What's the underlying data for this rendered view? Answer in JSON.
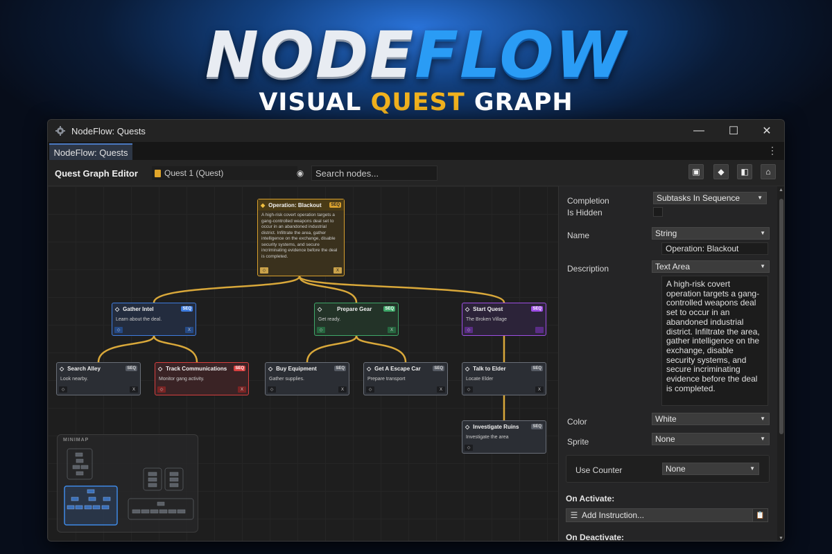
{
  "brand": {
    "part1": "NODE",
    "part2": "FLOW",
    "sub_pre": "VISUAL ",
    "sub_mid": "QUEST",
    "sub_post": " GRAPH"
  },
  "window": {
    "title": "NodeFlow: Quests",
    "tab": "NodeFlow: Quests"
  },
  "toolbar": {
    "title": "Quest Graph Editor",
    "quest_select": "Quest 1 (Quest)",
    "search_placeholder": "Search nodes...",
    "icons": [
      "image-icon",
      "diamond-icon",
      "panel-toggle-icon",
      "home-icon"
    ]
  },
  "colors": {
    "root": "#d8a02d",
    "blue": "#3f7de0",
    "green": "#3fa86a",
    "purple": "#9f4fe6",
    "red": "#d84040",
    "link": "#d9a83a"
  },
  "graph": {
    "root": {
      "title": "Operation: Blackout",
      "badge": "SEQ",
      "desc": "A high-risk covert operation targets a gang-controlled weapons deal set to occur in an abandoned industrial district. Infiltrate the area, gather intelligence on the exchange, disable security systems, and secure incriminating evidence before the deal is completed.",
      "x_label": "X"
    },
    "nodes": [
      {
        "title": "Gather Intel",
        "badge": "SEQ",
        "desc": "Learn about the deal.",
        "x_label": "X"
      },
      {
        "title": "Prepare Gear",
        "badge": "SEQ",
        "desc": "Get ready.",
        "x_label": "X"
      },
      {
        "title": "Start Quest",
        "badge": "SEQ",
        "desc": "The Broken Village",
        "x_label": ""
      },
      {
        "title": "Search Alley",
        "badge": "SEQ",
        "desc": "Look nearby.",
        "x_label": "X"
      },
      {
        "title": "Track Communications",
        "badge": "SEQ",
        "desc": "Monitor gang activity.",
        "x_label": "X"
      },
      {
        "title": "Buy Equipment",
        "badge": "SEQ",
        "desc": "Gather supplies.",
        "x_label": "X"
      },
      {
        "title": "Get A Escape Car",
        "badge": "SEQ",
        "desc": "Prepare transport",
        "x_label": "X"
      },
      {
        "title": "Talk to Elder",
        "badge": "SEQ",
        "desc": "Locate Elder",
        "x_label": "X"
      },
      {
        "title": "Investigate Ruins",
        "badge": "SEQ",
        "desc": "Investigate the area",
        "x_label": ""
      }
    ],
    "minimap_label": "MINIMAP"
  },
  "inspector": {
    "completion_label": "Completion",
    "completion_value": "Subtasks In Sequence",
    "hidden_label": "Is Hidden",
    "name_label": "Name",
    "name_type": "String",
    "name_value": "Operation: Blackout",
    "desc_label": "Description",
    "desc_type": "Text Area",
    "desc_value": "A high-risk covert operation targets a gang-controlled weapons deal set to occur in an abandoned industrial district. Infiltrate the area, gather intelligence on the exchange, disable security systems, and secure incriminating evidence before the deal is completed.",
    "color_label": "Color",
    "color_value": "White",
    "sprite_label": "Sprite",
    "sprite_value": "None",
    "counter_label": "Use Counter",
    "counter_value": "None",
    "on_activate": "On Activate:",
    "add_instruction": "Add Instruction...",
    "on_deactivate": "On Deactivate:"
  }
}
